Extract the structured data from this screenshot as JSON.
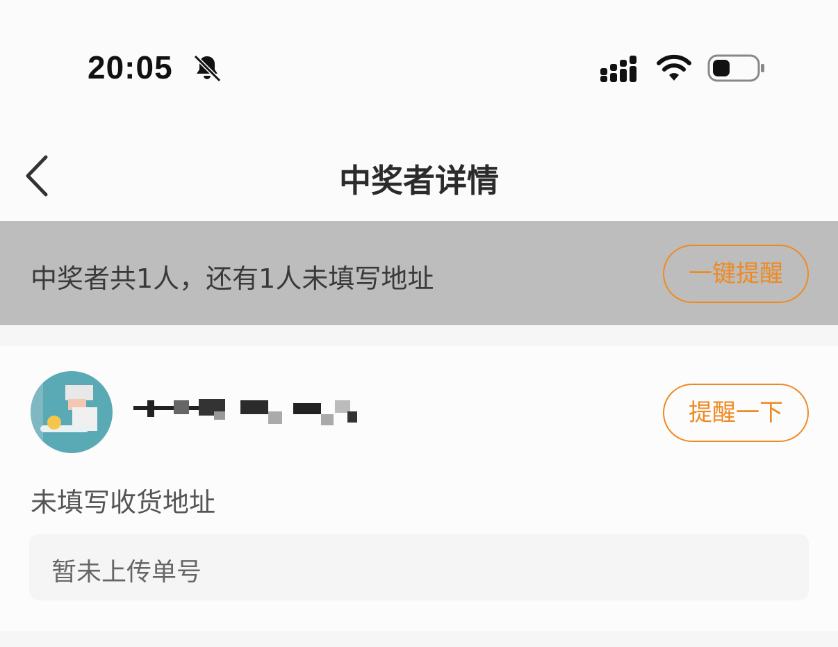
{
  "status_bar": {
    "time": "20:05",
    "icons": [
      "bell-muted-icon",
      "signal-icon",
      "wifi-icon",
      "battery-icon"
    ]
  },
  "nav": {
    "title": "中奖者详情",
    "back_icon": "chevron-left-icon"
  },
  "banner": {
    "summary": "中奖者共1人，还有1人未填写地址",
    "remind_all_label": "一键提醒"
  },
  "winner": {
    "address_status": "未填写收货地址",
    "remind_label": "提醒一下",
    "tracking_placeholder": "暂未上传单号"
  },
  "colors": {
    "accent": "#ef8a22",
    "banner_bg": "#bdbdbd",
    "page_bg": "#f6f6f6"
  }
}
